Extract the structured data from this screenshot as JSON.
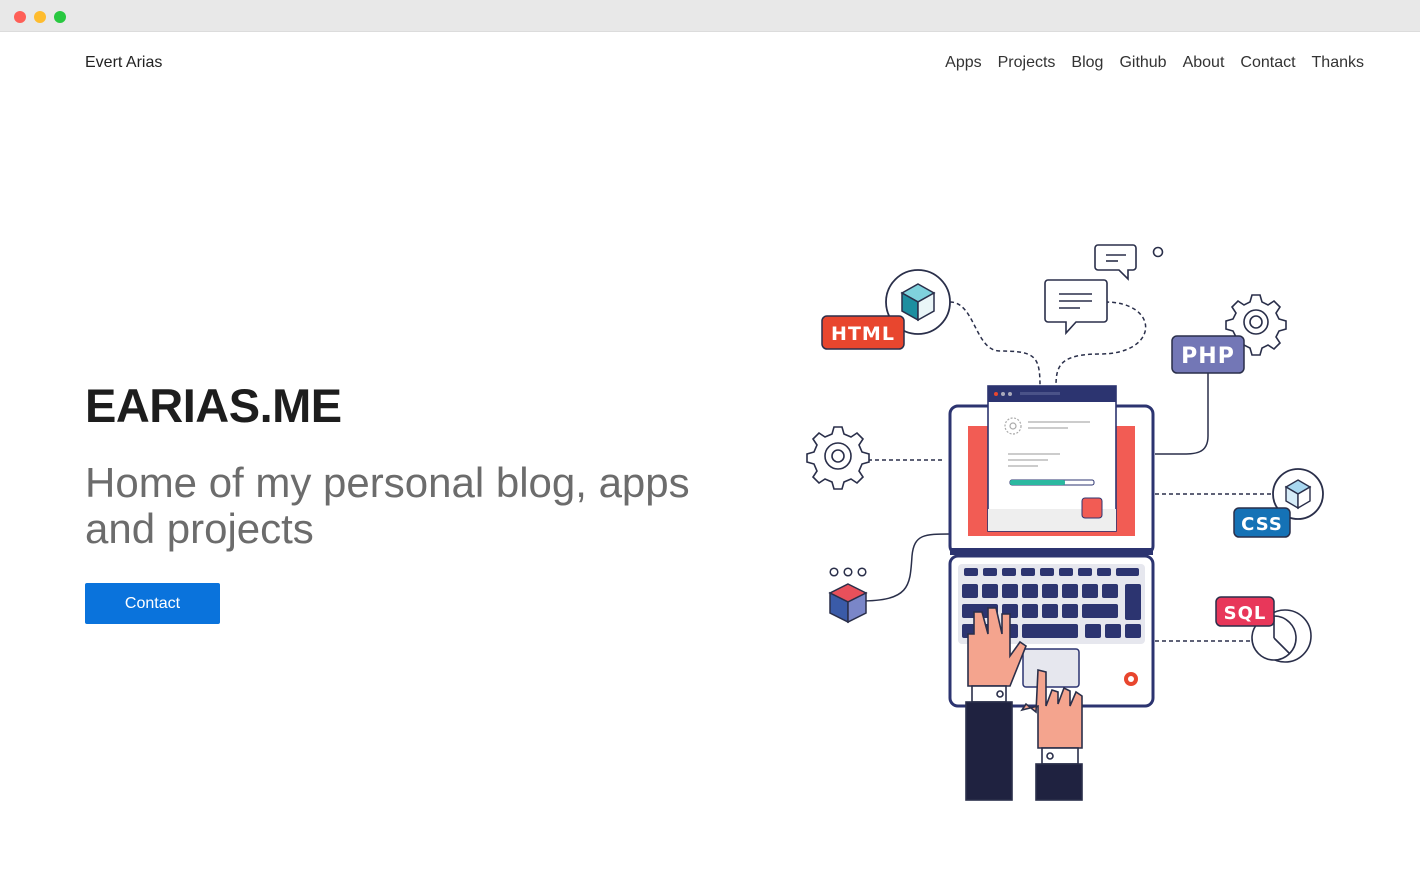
{
  "window": {
    "title_bar_buttons": [
      "close",
      "minimize",
      "maximize"
    ]
  },
  "header": {
    "brand": "Evert Arias",
    "nav": [
      "Apps",
      "Projects",
      "Blog",
      "Github",
      "About",
      "Contact",
      "Thanks"
    ]
  },
  "hero": {
    "title": "EARIAS.ME",
    "subtitle": "Home of my personal blog, apps and projects",
    "button_label": "Contact"
  },
  "illustration": {
    "tags": {
      "html": "HTML",
      "php": "PHP",
      "css": "CSS",
      "sql": "SQL"
    }
  },
  "colors": {
    "accent_button": "#0a73dc",
    "html_tag": "#e8462e",
    "php_tag": "#7377b6",
    "css_tag": "#1572b6",
    "sql_tag": "#e8375a",
    "laptop_outline": "#2c3470"
  }
}
